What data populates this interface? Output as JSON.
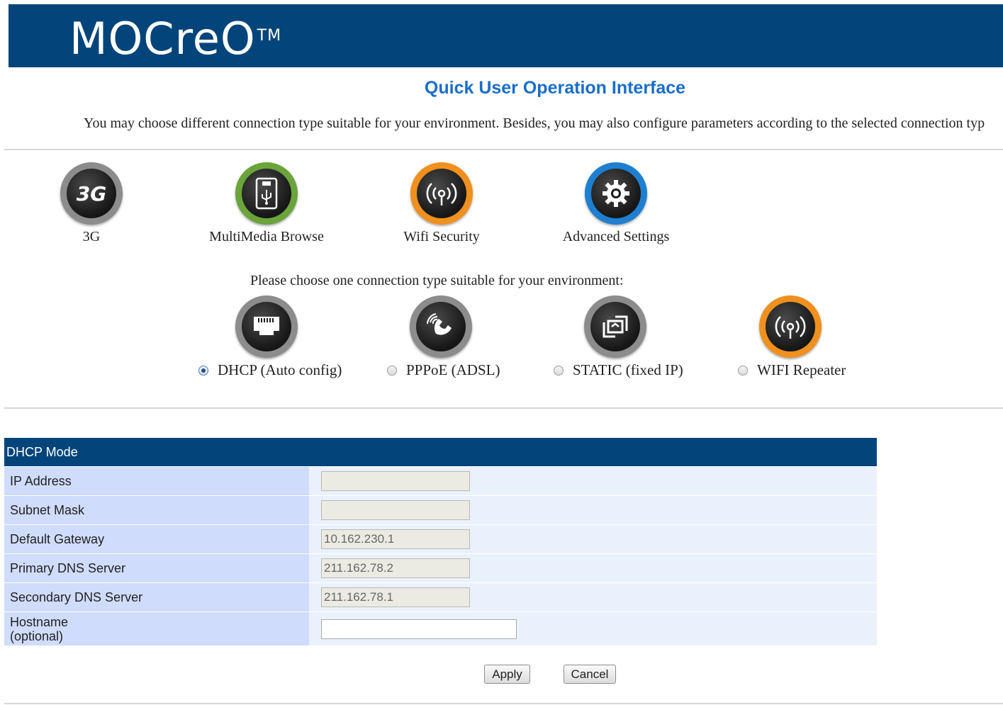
{
  "header": {
    "brand": "MOCreO",
    "tm": "TM"
  },
  "page": {
    "title": "Quick User Operation Interface",
    "description": "You may choose different connection type suitable for your environment. Besides, you may also configure parameters according to the selected connection typ"
  },
  "features": [
    {
      "label": "3G",
      "icon": "3g-icon",
      "ring_color": "#8c8c8c"
    },
    {
      "label": "MultiMedia Browse",
      "icon": "usb-drive-icon",
      "ring_color": "#6aa43a"
    },
    {
      "label": "Wifi Security",
      "icon": "wifi-signal-icon",
      "ring_color": "#f0901e"
    },
    {
      "label": "Advanced Settings",
      "icon": "gear-icon",
      "ring_color": "#1e7fd0"
    }
  ],
  "connection": {
    "prompt": "Please choose one connection type suitable for your environment:",
    "options": [
      {
        "label": "DHCP (Auto config)",
        "icon": "ethernet-icon",
        "selected": true
      },
      {
        "label": "PPPoE (ADSL)",
        "icon": "phone-icon",
        "selected": false
      },
      {
        "label": "STATIC (fixed IP)",
        "icon": "static-ip-icon",
        "selected": false
      },
      {
        "label": "WIFI Repeater",
        "icon": "wifi-signal-icon",
        "selected": false
      }
    ]
  },
  "dhcp": {
    "title": "DHCP Mode",
    "rows": [
      {
        "label": "IP Address",
        "value": ""
      },
      {
        "label": "Subnet Mask",
        "value": ""
      },
      {
        "label": "Default Gateway",
        "value": "10.162.230.1"
      },
      {
        "label": "Primary DNS Server",
        "value": "211.162.78.2"
      },
      {
        "label": "Secondary DNS Server",
        "value": "211.162.78.1"
      }
    ],
    "hostname_label_1": "Hostname",
    "hostname_label_2": "(optional)",
    "hostname_value": ""
  },
  "buttons": {
    "apply": "Apply",
    "cancel": "Cancel"
  },
  "colors": {
    "header_bg": "#03457a",
    "title_blue": "#1a6ec8",
    "label_bg": "#cfdcfb",
    "value_bg": "#ebf1fc"
  }
}
